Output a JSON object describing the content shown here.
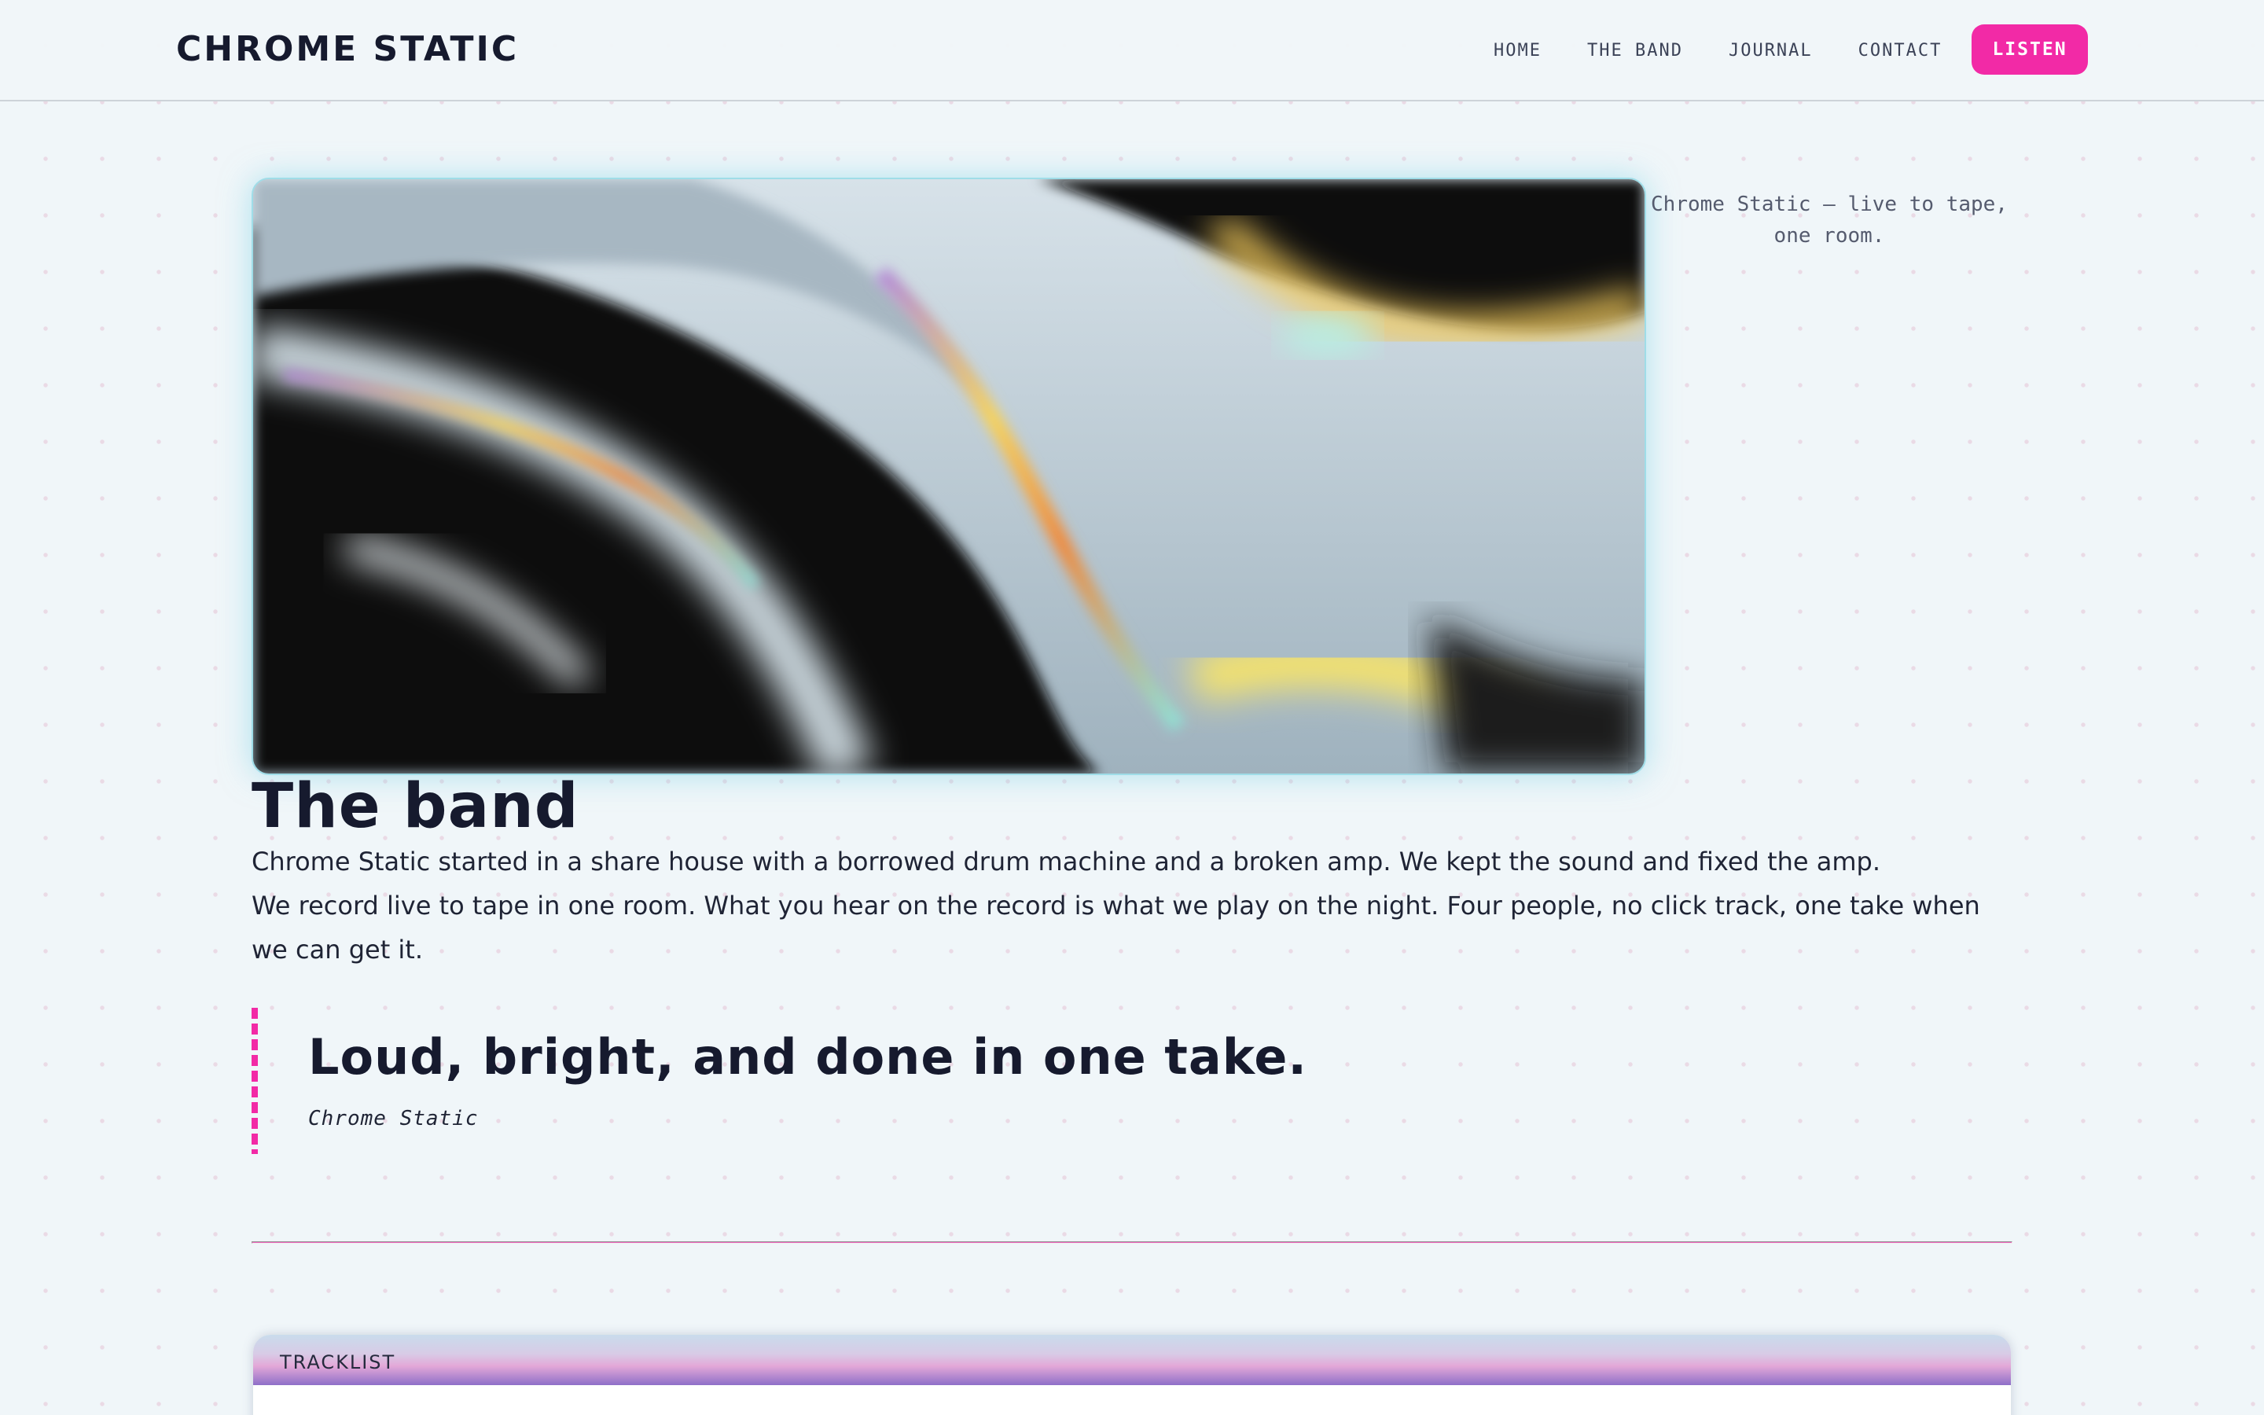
{
  "header": {
    "brand": "CHROME STATIC",
    "nav": [
      {
        "label": "HOME"
      },
      {
        "label": "THE BAND"
      },
      {
        "label": "JOURNAL"
      },
      {
        "label": "CONTACT"
      }
    ],
    "cta_label": "LISTEN"
  },
  "hero": {
    "caption": "Chrome Static — live to tape, one room."
  },
  "band": {
    "title": "The band",
    "paragraphs": [
      "Chrome Static started in a share house with a borrowed drum machine and a broken amp. We kept the sound and fixed the amp.",
      "We record live to tape in one room. What you hear on the record is what we play on the night. Four people, no click track, one take when we can get it."
    ],
    "quote": {
      "text": "Loud, bright, and done in one take.",
      "cite": "Chrome Static"
    }
  },
  "tracklist": {
    "title": "TRACKLIST"
  },
  "colors": {
    "accent": "#f22aa6",
    "background": "#f0f6f9",
    "text": "#161a2e",
    "divider": "#e85fb8",
    "hero_glow": "#9fdde8"
  },
  "icons": []
}
